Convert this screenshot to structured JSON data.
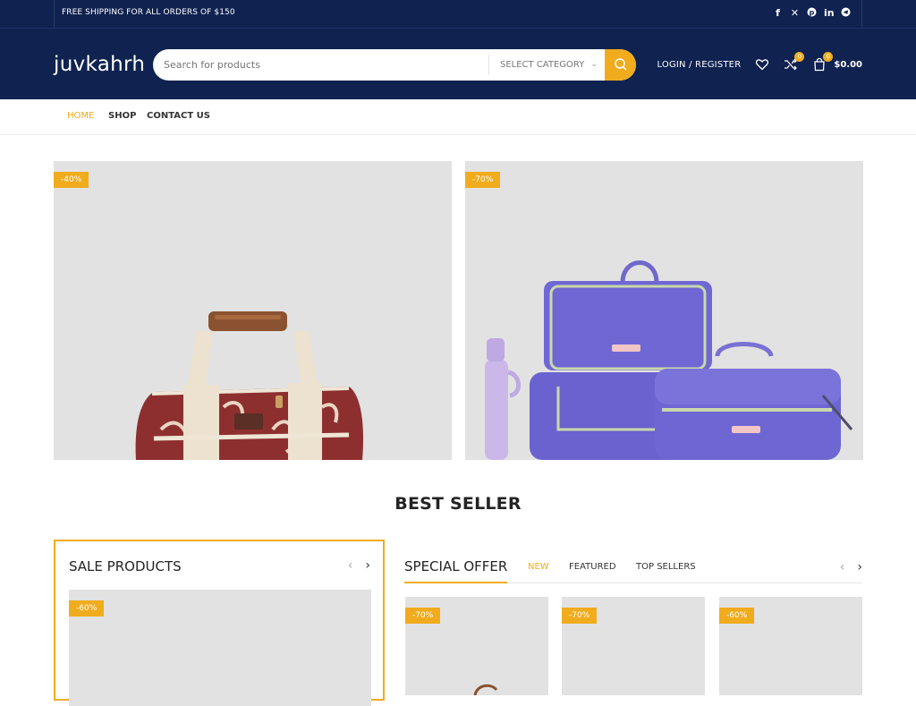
{
  "topbar": {
    "promo": "FREE SHIPPING FOR ALL ORDERS OF $150",
    "social_icons": [
      "facebook-icon",
      "x-icon",
      "pinterest-icon",
      "linkedin-icon",
      "telegram-icon"
    ]
  },
  "header": {
    "logo": "juvkahrh",
    "search_placeholder": "Search for products",
    "category_label": "SELECT CATEGORY",
    "login_label": "LOGIN / REGISTER",
    "compare_count": "0",
    "cart_count": "0",
    "cart_total": "$0.00"
  },
  "nav": {
    "items": [
      "HOME",
      "SHOP",
      "CONTACT US"
    ],
    "active": "HOME"
  },
  "banners": [
    {
      "badge": "-40%"
    },
    {
      "badge": "-70%"
    }
  ],
  "section_title": "BEST SELLER",
  "sale_products": {
    "title": "SALE PRODUCTS",
    "badge": "-60%"
  },
  "tabs": {
    "main": "SPECIAL OFFER",
    "items": [
      "NEW",
      "FEATURED",
      "TOP SELLERS"
    ]
  },
  "cards": [
    {
      "badge": "-70%"
    },
    {
      "badge": "-70%"
    },
    {
      "badge": "-60%"
    }
  ],
  "colors": {
    "navy": "#0f2250",
    "accent": "#f0ac1d",
    "image_bg": "#e2e2e2"
  }
}
